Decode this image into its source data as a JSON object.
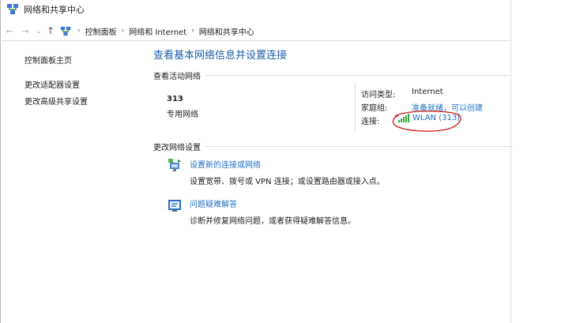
{
  "window": {
    "title": "网络和共享中心"
  },
  "navbar": {
    "breadcrumbs": [
      "控制面板",
      "网络和 Internet",
      "网络和共享中心"
    ],
    "icons": {
      "back": "arrow-left-icon",
      "forward": "arrow-right-icon",
      "recent": "chevron-down-icon",
      "up": "arrow-up-icon"
    }
  },
  "sidebar": {
    "items": [
      {
        "label": "控制面板主页"
      },
      {
        "label": "更改适配器设置"
      },
      {
        "label": "更改高级共享设置"
      }
    ]
  },
  "main": {
    "title": "查看基本网络信息并设置连接",
    "active_header": "查看活动网络",
    "network": {
      "name": "313",
      "type": "专用网络",
      "access_type_label": "访问类型:",
      "access_type_value": "Internet",
      "homegroup_label": "家庭组:",
      "homegroup_value": "准备就绪，可以创建",
      "connection_label": "连接:",
      "connection_value": "WLAN (313)"
    },
    "change_header": "更改网络设置",
    "tasks": [
      {
        "link": "设置新的连接或网络",
        "desc": "设置宽带、拨号或 VPN 连接；或设置路由器或接入点。",
        "icon": "network-setup-icon"
      },
      {
        "link": "问题疑难解答",
        "desc": "诊断并修复网络问题，或者获得疑难解答信息。",
        "icon": "troubleshoot-icon"
      }
    ]
  },
  "colors": {
    "link": "#1f6fc5",
    "title": "#1f5da8",
    "annotation": "#d01818"
  }
}
